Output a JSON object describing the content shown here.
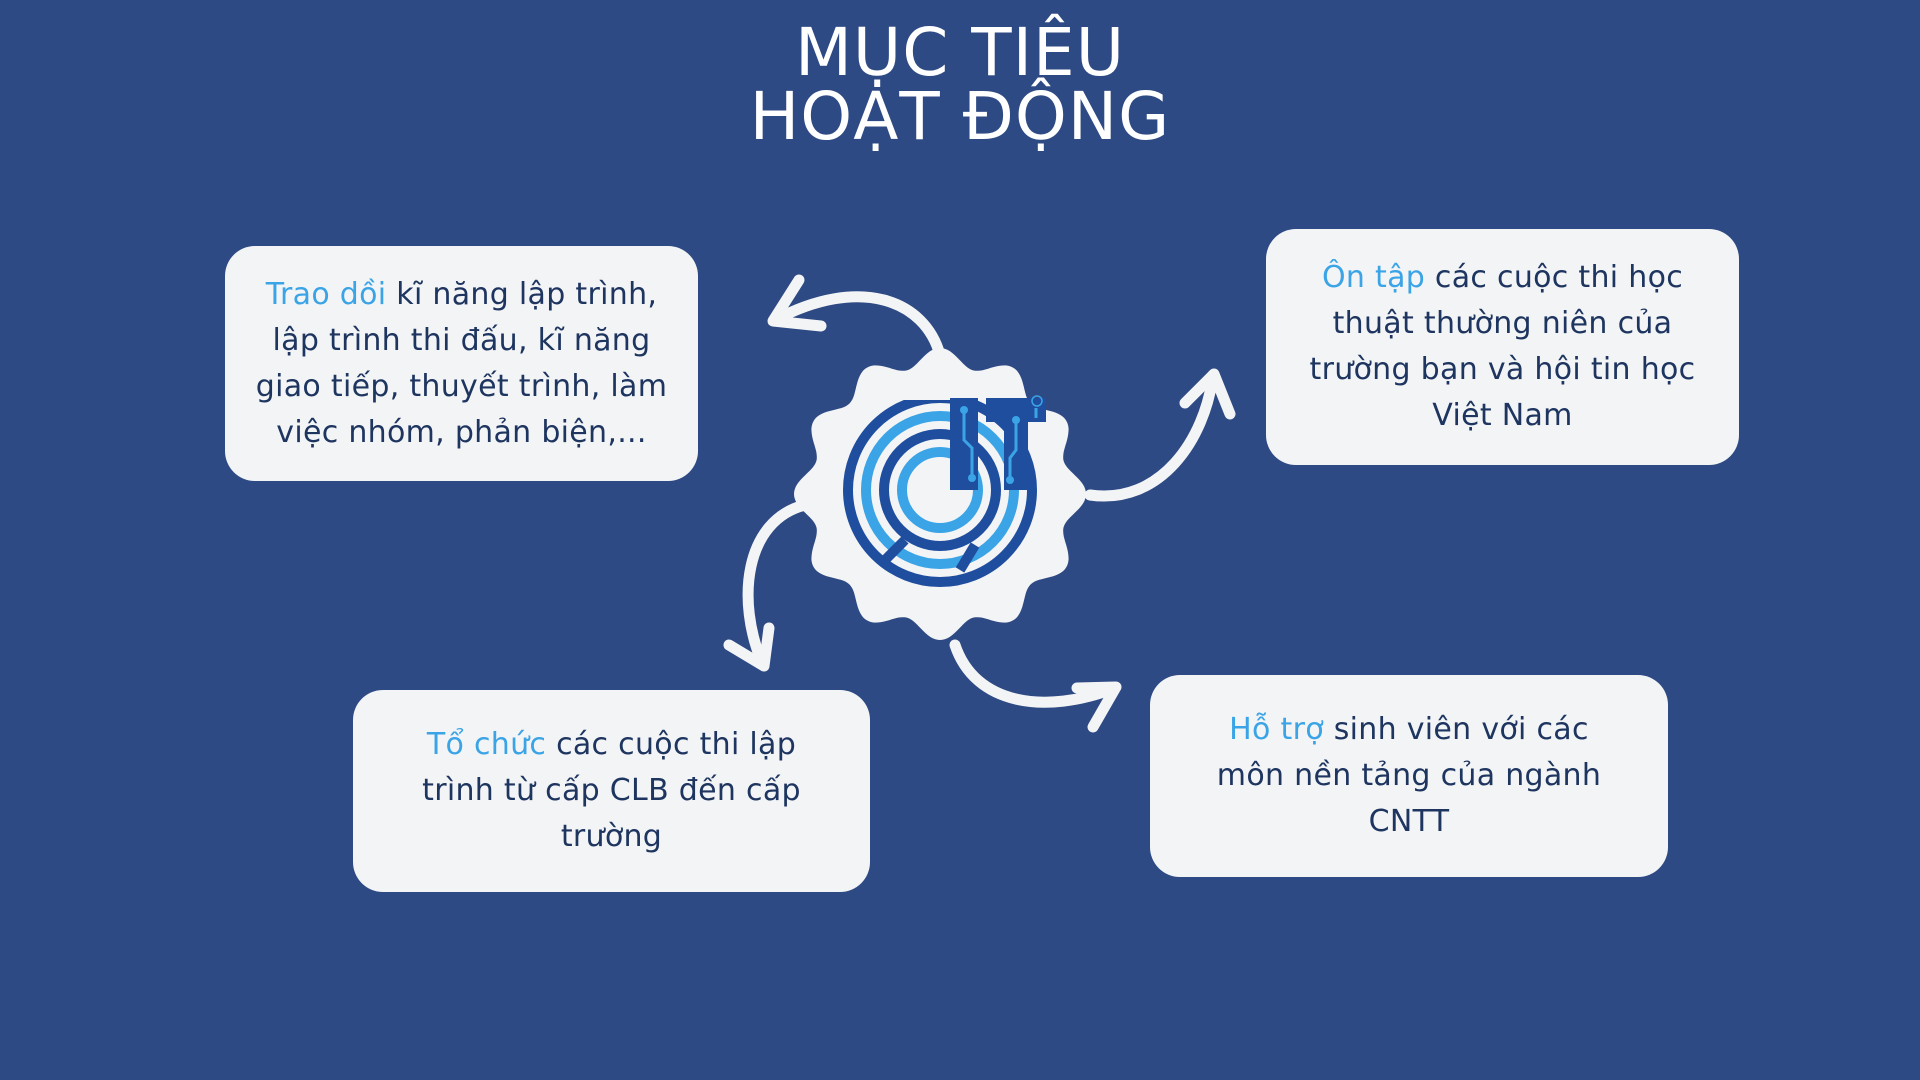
{
  "title": {
    "line1": "MỤC TIÊU",
    "line2": "HOẠT ĐỘNG"
  },
  "logo": {
    "text": "IT",
    "icon": "it-circuit-logo"
  },
  "cards": {
    "top_left": {
      "highlight": "Trao dồi",
      "lines": [
        " kĩ năng lập trình,",
        "lập trình thi đấu, kĩ năng",
        "giao tiếp, thuyết trình, làm",
        "việc nhóm, phản biện,..."
      ]
    },
    "top_right": {
      "highlight": "Ôn tập",
      "lines": [
        " các cuộc thi học",
        "thuật thường niên của",
        "trường bạn và hội tin học",
        "Việt Nam"
      ]
    },
    "bottom_left": {
      "highlight": "Tổ chức",
      "lines": [
        " các cuộc thi lập",
        "trình từ cấp CLB đến cấp",
        "trường"
      ]
    },
    "bottom_right": {
      "highlight": "Hỗ trợ",
      "lines": [
        " sinh viên với các",
        "môn nền tảng của ngành",
        "CNTT"
      ]
    }
  },
  "colors": {
    "background": "#2E4A84",
    "card": "#F3F4F6",
    "text": "#1E3560",
    "highlight": "#3BA4E6",
    "logo_dark": "#1F4E9E",
    "logo_light": "#3BA4E6"
  }
}
